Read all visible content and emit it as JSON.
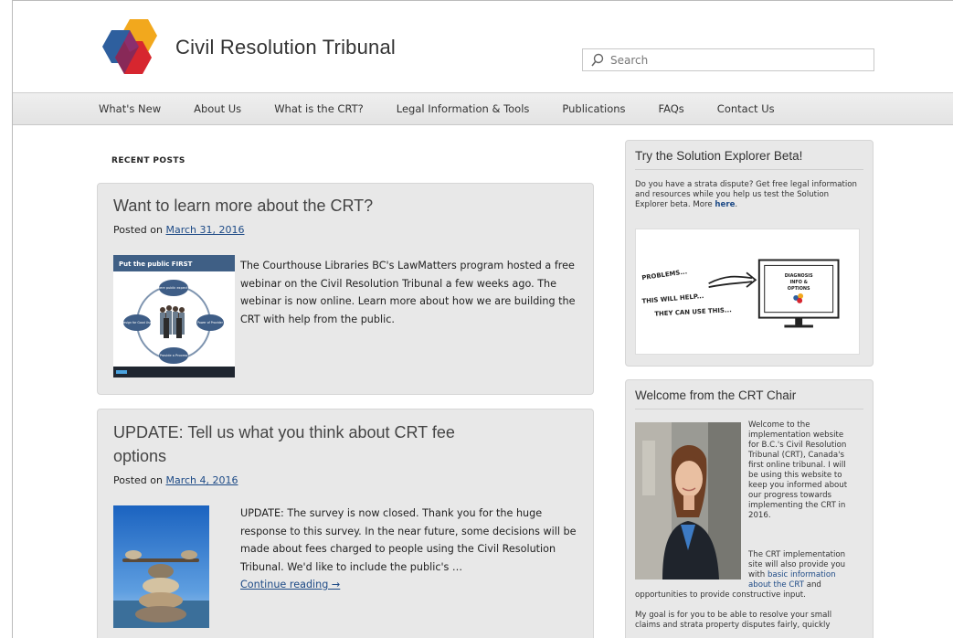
{
  "site": {
    "title": "Civil Resolution Tribunal"
  },
  "search": {
    "placeholder": "Search"
  },
  "nav": {
    "items": [
      "What's New",
      "About Us",
      "What is the CRT?",
      "Legal Information & Tools",
      "Publications",
      "FAQs",
      "Contact Us"
    ]
  },
  "main": {
    "recent_label": "RECENT POSTS",
    "posts": [
      {
        "title": "Want to learn more about the CRT?",
        "posted_on": "Posted on",
        "date": "March 31, 2016",
        "excerpt": "The Courthouse Libraries BC's LawMatters program hosted a free webinar on the Civil Resolution Tribunal a few weeks ago. The webinar is now online. Learn more about how we are building the CRT with help from the public.",
        "thumb": {
          "heading": "Put the public FIRST",
          "labels": [
            "Where public expect it?",
            "Design for Good User",
            "Power of Provider",
            "Provide a Process"
          ]
        }
      },
      {
        "title_line1": "UPDATE: Tell us what you think about CRT fee",
        "title_line2": "options",
        "posted_on": "Posted on",
        "date": "March 4, 2016",
        "excerpt": "UPDATE: The survey is now closed. Thank you for the huge response to this survey. In the near future, some decisions will be made about fees charged to people using the Civil Resolution Tribunal. We'd like to include the public's …",
        "continue": "Continue reading →"
      }
    ]
  },
  "sidebar": {
    "explorer": {
      "title": "Try the Solution Explorer Beta!",
      "text": "Do you have a strata dispute? Get free legal information and resources while you help us test the Solution Explorer beta. More",
      "link": "here",
      "image_text": {
        "problems": "PROBLEMS...",
        "help": "THIS WILL HELP...",
        "use": "THEY CAN USE THIS...",
        "screen": [
          "DIAGNOSIS",
          "INFO &",
          "OPTIONS"
        ]
      }
    },
    "welcome": {
      "title": "Welcome from the CRT Chair",
      "p1": [
        "Welcome to the",
        "implementation website",
        "for B.C.'s Civil Resolution",
        "Tribunal (CRT), Canada's",
        "first online tribunal. I will",
        "be using this website to",
        "keep you informed about",
        "our progress towards",
        "implementing the CRT in",
        "2016."
      ],
      "p2_start": [
        "The CRT implementation",
        "site will also provide you",
        "with"
      ],
      "p2_link": [
        "basic information",
        "about the CRT"
      ],
      "p2_end": "and",
      "p2_last": "opportunities to provide constructive input.",
      "p3": [
        "My goal is for you to be able to resolve your small",
        "claims and strata property disputes fairly, quickly"
      ]
    }
  },
  "colors": {
    "link": "#1d4a86",
    "panel": "#e8e8e8"
  }
}
